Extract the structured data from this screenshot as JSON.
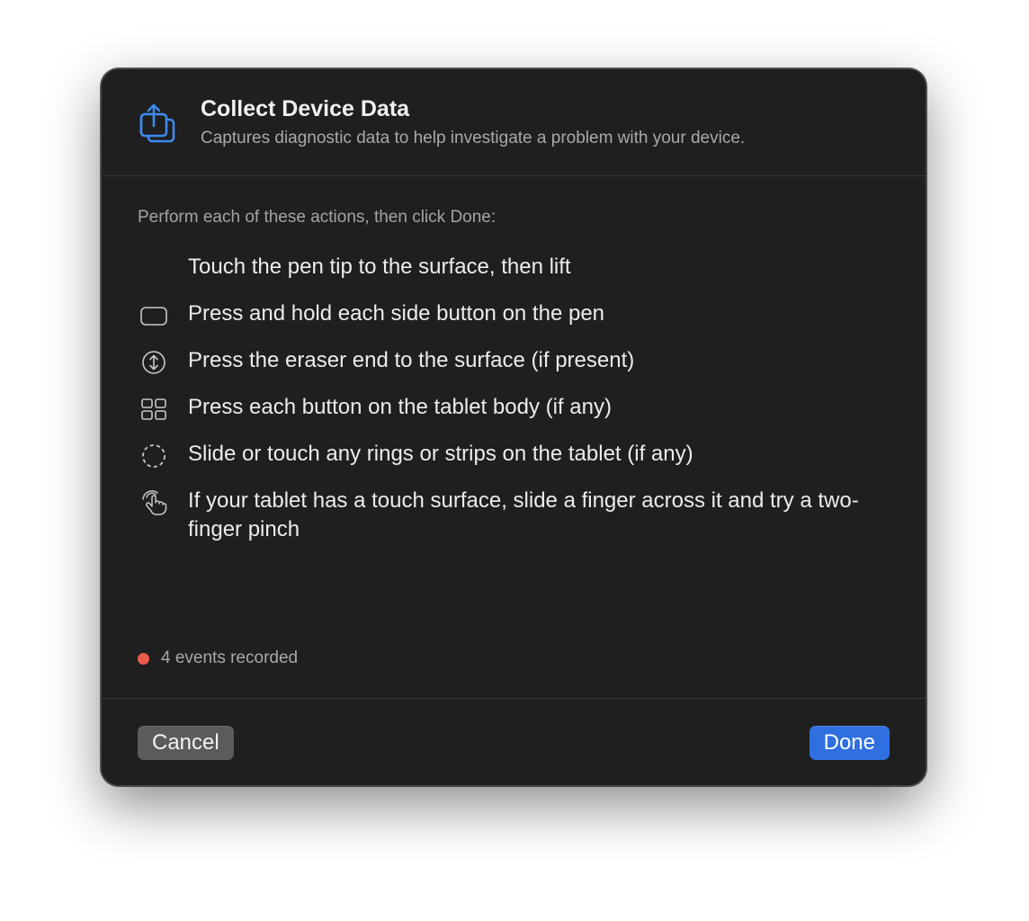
{
  "dialog": {
    "title": "Collect Device Data",
    "subtitle": "Captures diagnostic data to help investigate a problem with your device.",
    "header_icon": "share-box-icon",
    "instructions": "Perform each of these actions, then click Done:",
    "actions": [
      {
        "label": "Touch the pen tip to the surface, then lift",
        "icon": "none"
      },
      {
        "label": "Press and hold each side button on the pen",
        "icon": "rounded-rect-icon"
      },
      {
        "label": "Press the eraser end to the surface (if present)",
        "icon": "up-down-arrow-circle-icon"
      },
      {
        "label": "Press each button on the tablet body (if any)",
        "icon": "grid-icon"
      },
      {
        "label": "Slide or touch any rings or strips on the tablet (if any)",
        "icon": "dashed-circle-icon"
      },
      {
        "label": "If your tablet has a touch surface, slide a finger across it and try a two-finger pinch",
        "icon": "hand-tap-icon"
      }
    ],
    "status": {
      "text": "4 events recorded",
      "dot_color": "#ec5a4c"
    },
    "buttons": {
      "cancel_label": "Cancel",
      "done_label": "Done"
    },
    "accent_color": "#2f6fe0"
  }
}
